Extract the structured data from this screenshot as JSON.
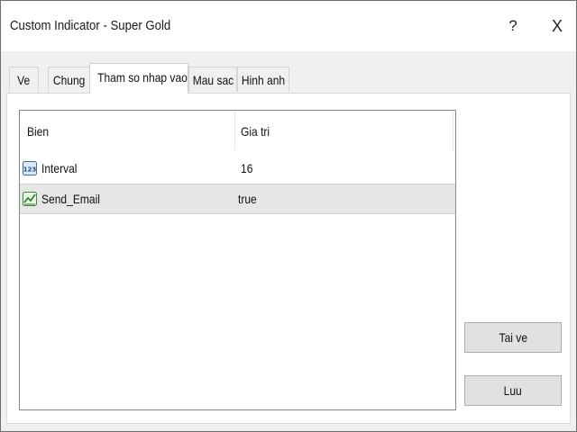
{
  "window": {
    "title": "Custom Indicator - Super Gold",
    "help_label": "?",
    "close_label": "X"
  },
  "tabs": [
    {
      "label": "Ve",
      "active": false
    },
    {
      "label": "Chung",
      "active": false
    },
    {
      "label": "Tham so nhap vao",
      "active": true
    },
    {
      "label": "Mau sac",
      "active": false
    },
    {
      "label": "Hinh anh",
      "active": false
    }
  ],
  "params_table": {
    "columns": [
      "Bien",
      "Gia tri"
    ],
    "rows": [
      {
        "icon": "numeric-123-icon",
        "name": "Interval",
        "value": "16",
        "selected": false
      },
      {
        "icon": "boolean-chart-icon",
        "name": "Send_Email",
        "value": "true",
        "selected": true
      }
    ]
  },
  "buttons": {
    "load_label": "Tai ve",
    "save_label": "Luu"
  }
}
